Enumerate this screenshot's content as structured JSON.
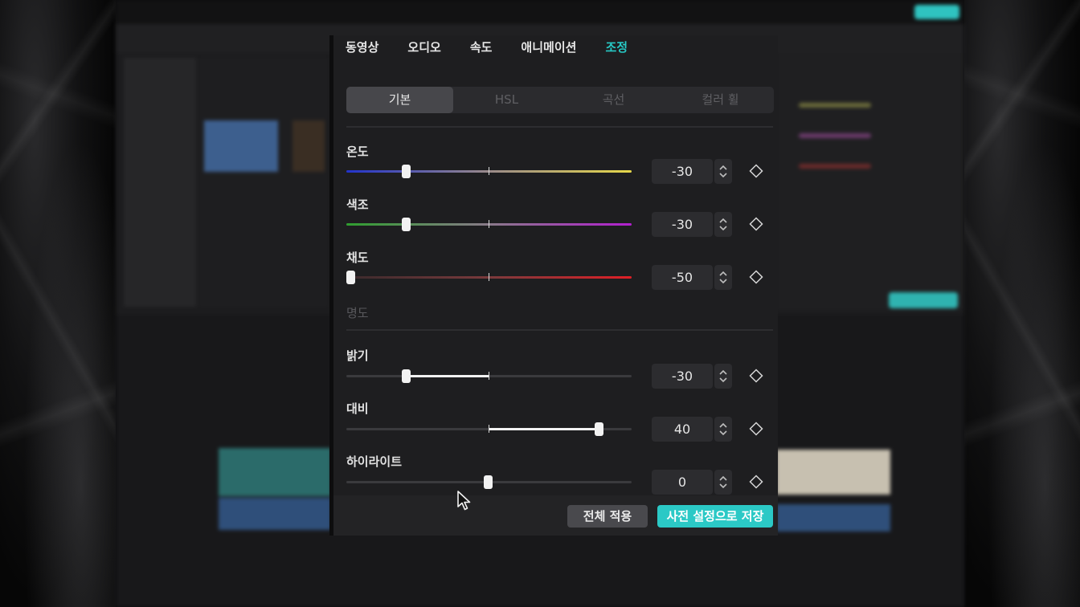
{
  "tabs": [
    {
      "label": "동영상",
      "active": false
    },
    {
      "label": "오디오",
      "active": false
    },
    {
      "label": "속도",
      "active": false
    },
    {
      "label": "애니메이션",
      "active": false
    },
    {
      "label": "조정",
      "active": true
    }
  ],
  "subtabs": [
    {
      "label": "기본",
      "active": true
    },
    {
      "label": "HSL",
      "active": false
    },
    {
      "label": "곡선",
      "active": false
    },
    {
      "label": "컬러 휠",
      "active": false
    }
  ],
  "colors": {
    "accent": "#27c8c4",
    "temperature_gradient": [
      "#2233cc",
      "#e6d84a"
    ],
    "tint_gradient": [
      "#2f9e2f",
      "#b21fcf"
    ],
    "saturation_gradient": [
      "#3a2a2c",
      "#e01f26"
    ]
  },
  "color_section": {
    "temperature": {
      "label": "온도",
      "value": "-30",
      "level": -30
    },
    "tint": {
      "label": "색조",
      "value": "-30",
      "level": -30
    },
    "saturation": {
      "label": "채도",
      "value": "-50",
      "level": -50
    }
  },
  "lightness_section": {
    "heading": "명도",
    "brightness": {
      "label": "밝기",
      "value": "-30",
      "level": -30
    },
    "contrast": {
      "label": "대비",
      "value": "40",
      "level": 40
    },
    "highlight": {
      "label": "하이라이트",
      "value": "0",
      "level": 0
    }
  },
  "icons": {
    "stepper": "up-down-chevron-icon",
    "keyframe": "diamond-icon",
    "cursor": "mouse-pointer-icon"
  },
  "footer": {
    "apply_all": "전체 적용",
    "save_preset": "사전 설정으로 저장"
  }
}
